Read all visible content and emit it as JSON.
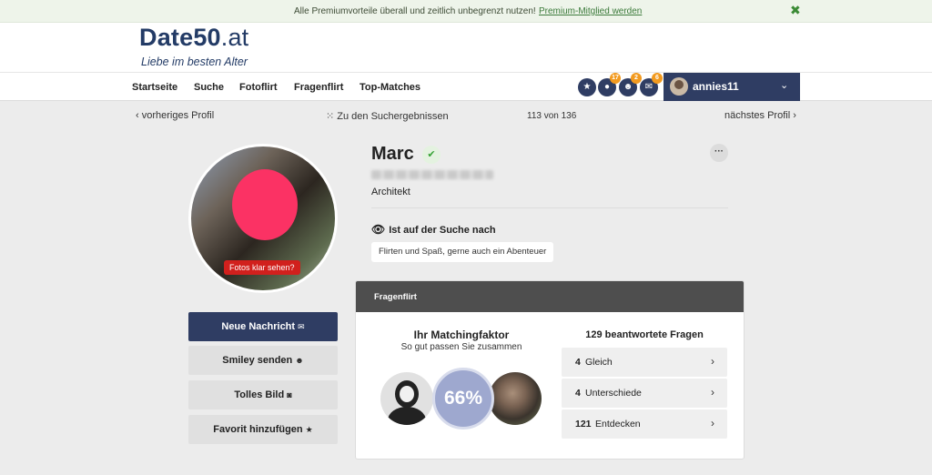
{
  "promo": {
    "text": "Alle Premiumvorteile überall und zeitlich unbegrenzt nutzen!",
    "link": "Premium-Mitglied werden",
    "close_icon": "✖"
  },
  "brand": {
    "logo_bold": "Date50",
    "logo_tld": ".at",
    "tagline": "Liebe im besten Alter",
    "color": "#233b66"
  },
  "nav": {
    "items": [
      "Startseite",
      "Suche",
      "Fotoflirt",
      "Fragenflirt",
      "Top-Matches"
    ],
    "icons": [
      {
        "name": "star-icon",
        "glyph": "★",
        "badge": ""
      },
      {
        "name": "visitors-icon",
        "glyph": "●",
        "badge": "17"
      },
      {
        "name": "smiley-icon",
        "glyph": "☻",
        "badge": "2"
      },
      {
        "name": "mail-icon",
        "glyph": "✉",
        "badge": "6"
      }
    ],
    "username": "annies11",
    "chevron": "⌄"
  },
  "pager": {
    "prev": "‹  vorheriges Profil",
    "results": "Zu den Suchergebnissen",
    "grid_icon": "⁙",
    "position": "113 von 136",
    "next": "nächstes Profil  ›"
  },
  "profile": {
    "photo_button": "Fotos klar sehen?",
    "name": "Marc",
    "verified_icon": "✔",
    "more_icon": "···",
    "job": "Architekt",
    "search_title": "Ist auf der Suche nach",
    "eye_icon": "👁",
    "search_tag": "Flirten und Spaß, gerne auch ein Abenteuer"
  },
  "actions": {
    "message": "Neue Nachricht",
    "message_icon": "✉",
    "smiley": "Smiley senden",
    "smiley_icon": "☻",
    "photo": "Tolles Bild",
    "photo_icon": "◙",
    "favorite": "Favorit hinzufügen",
    "favorite_icon": "★"
  },
  "fragenflirt": {
    "title": "Fragenflirt",
    "match_title": "Ihr Matchingfaktor",
    "match_sub": "So gut passen Sie zusammen",
    "percent": "66%",
    "answered": "129 beantwortete Fragen",
    "stats": [
      {
        "num": "4",
        "label": "Gleich"
      },
      {
        "num": "4",
        "label": "Unterschiede"
      },
      {
        "num": "121",
        "label": "Entdecken"
      }
    ],
    "chevron": "›"
  }
}
